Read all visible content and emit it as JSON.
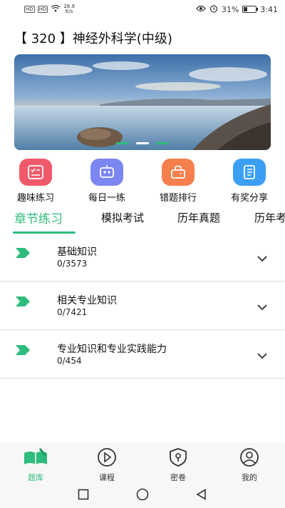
{
  "status_bar": {
    "signal1": "HD",
    "signal2": "HD",
    "net_speed_value": "28.9",
    "net_speed_unit": "K/s",
    "battery_text": "31%",
    "time": "3:41",
    "battery_level": 0.31
  },
  "header": {
    "title": "【 320 】神经外科学(中级)"
  },
  "banner": {
    "slide_count": 3,
    "active_slide": 1
  },
  "quick_menu": [
    {
      "label": "趣味练习",
      "icon": "quiz-icon",
      "color": "#f0596a"
    },
    {
      "label": "每日一练",
      "icon": "robot-icon",
      "color": "#7b86f0"
    },
    {
      "label": "错题排行",
      "icon": "ranking-icon",
      "color": "#f57f4d"
    },
    {
      "label": "有奖分享",
      "icon": "notebook-icon",
      "color": "#3a9ff5"
    }
  ],
  "tabs": [
    {
      "label": "章节练习",
      "active": true
    },
    {
      "label": "模拟考试"
    },
    {
      "label": "历年真题"
    },
    {
      "label": "历年考"
    }
  ],
  "chapters": [
    {
      "title": "基础知识",
      "progress": "0/3573"
    },
    {
      "title": "相关专业知识",
      "progress": "0/7421"
    },
    {
      "title": "专业知识和专业实践能力",
      "progress": "0/454"
    }
  ],
  "bottom_nav": [
    {
      "label": "题库",
      "icon": "question-bank-icon",
      "active": true
    },
    {
      "label": "课程",
      "icon": "play-icon"
    },
    {
      "label": "密卷",
      "icon": "lock-shield-icon"
    },
    {
      "label": "我的",
      "icon": "user-icon"
    }
  ],
  "colors": {
    "accent": "#2ebc7c"
  }
}
